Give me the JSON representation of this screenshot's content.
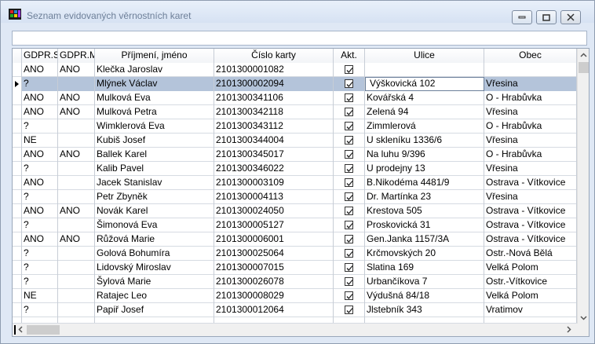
{
  "window": {
    "title": "Seznam evidovaných věrnostních karet"
  },
  "filter": {
    "value": ""
  },
  "grid": {
    "columns": [
      "GDPR.S",
      "GDPR.M",
      "Příjmení, jméno",
      "Číslo karty",
      "Akt.",
      "Ulice",
      "Obec"
    ],
    "rows": [
      {
        "gs": "ANO",
        "gm": "ANO",
        "name": "Klečka Jaroslav",
        "card": "2101300001082",
        "akt": true,
        "street": "",
        "town": ""
      },
      {
        "gs": "?",
        "gm": "",
        "name": "Mlýnek Václav",
        "card": "2101300002094",
        "akt": true,
        "street": "Výškovická 102",
        "town": "Vřesina",
        "selected": true
      },
      {
        "gs": "ANO",
        "gm": "ANO",
        "name": "Mulková Eva",
        "card": "2101300341106",
        "akt": true,
        "street": "Kovářská 4",
        "town": "O - Hrabůvka"
      },
      {
        "gs": "ANO",
        "gm": "ANO",
        "name": "Mulková Petra",
        "card": "2101300342118",
        "akt": true,
        "street": "Zelená 94",
        "town": "Vřesina"
      },
      {
        "gs": "?",
        "gm": "",
        "name": "Wimklerová Eva",
        "card": "2101300343112",
        "akt": true,
        "street": "Zimmlerová",
        "town": "O - Hrabůvka"
      },
      {
        "gs": "NE",
        "gm": "",
        "name": "Kubiš Josef",
        "card": "2101300344004",
        "akt": true,
        "street": "U skleníku 1336/6",
        "town": "Vřesina"
      },
      {
        "gs": "ANO",
        "gm": "ANO",
        "name": "Ballek Karel",
        "card": "2101300345017",
        "akt": true,
        "street": "Na luhu 9/396",
        "town": "O - Hrabůvka"
      },
      {
        "gs": "?",
        "gm": "",
        "name": "Kalib Pavel",
        "card": "2101300346022",
        "akt": true,
        "street": "U prodejny 13",
        "town": "Vřesina"
      },
      {
        "gs": "ANO",
        "gm": "",
        "name": "Jacek Stanislav",
        "card": "2101300003109",
        "akt": true,
        "street": "B.Nikodéma 4481/9",
        "town": "Ostrava - Vítkovice"
      },
      {
        "gs": "?",
        "gm": "",
        "name": "Petr Zbyněk",
        "card": "2101300004113",
        "akt": true,
        "street": "Dr. Martínka 23",
        "town": "Vřesina"
      },
      {
        "gs": "ANO",
        "gm": "ANO",
        "name": "Novák Karel",
        "card": "2101300024050",
        "akt": true,
        "street": "Krestova 505",
        "town": "Ostrava - Vítkovice"
      },
      {
        "gs": "?",
        "gm": "",
        "name": "Šimonová Eva",
        "card": "2101300005127",
        "akt": true,
        "street": "Proskovická 31",
        "town": "Ostrava - Vítkovice"
      },
      {
        "gs": "ANO",
        "gm": "ANO",
        "name": "Růžová Marie",
        "card": "2101300006001",
        "akt": true,
        "street": "Gen.Janka 1157/3A",
        "town": "Ostrava - Vítkovice"
      },
      {
        "gs": "?",
        "gm": "",
        "name": "Golová Bohumíra",
        "card": "2101300025064",
        "akt": true,
        "street": "Krčmovských 20",
        "town": "Ostr.-Nová Bělá"
      },
      {
        "gs": "?",
        "gm": "",
        "name": "Lidovský Miroslav",
        "card": "2101300007015",
        "akt": true,
        "street": "Slatina 169",
        "town": "Velká Polom"
      },
      {
        "gs": "?",
        "gm": "",
        "name": "Šylová Marie",
        "card": "2101300026078",
        "akt": true,
        "street": "Urbančíkova 7",
        "town": "Ostr.-Vítkovice"
      },
      {
        "gs": "NE",
        "gm": "",
        "name": "Ratajec Leo",
        "card": "2101300008029",
        "akt": true,
        "street": "Výdušná 84/18",
        "town": "Velká Polom"
      },
      {
        "gs": "?",
        "gm": "",
        "name": "Papiř Josef",
        "card": "2101300012064",
        "akt": true,
        "street": "Jlstebník 343",
        "town": "Vratimov"
      }
    ]
  },
  "colors": {
    "selected_row": "#b4c4da",
    "title_text": "#6d7f98"
  }
}
